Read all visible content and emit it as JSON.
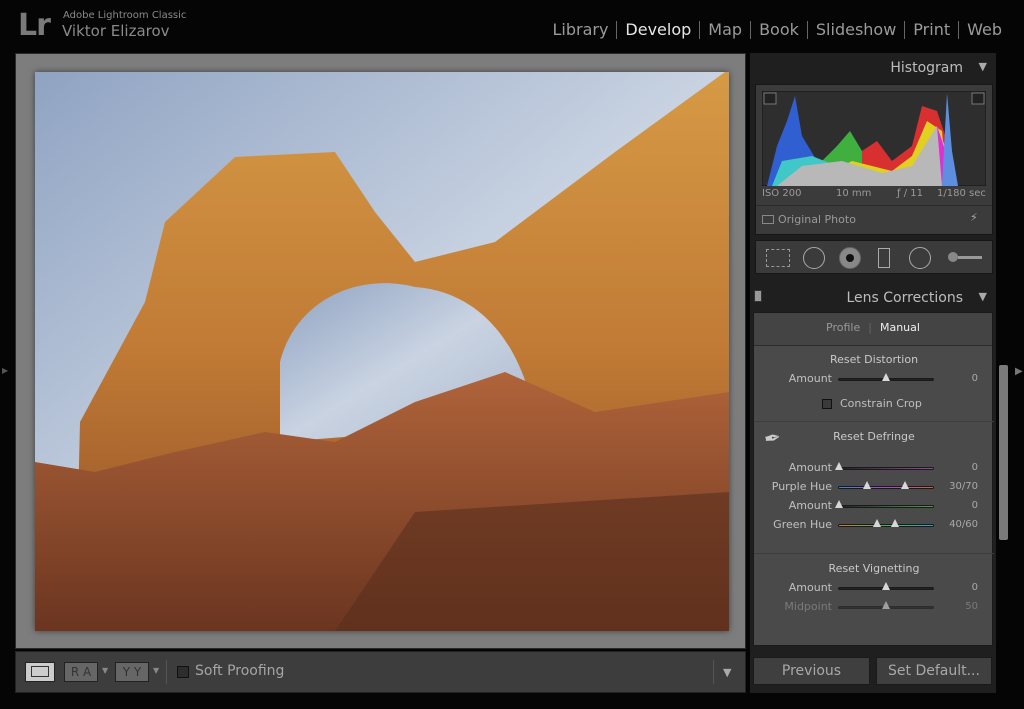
{
  "header": {
    "logo": "Lr",
    "app_name": "Adobe Lightroom Classic",
    "user": "Viktor Elizarov",
    "modules": [
      {
        "label": "Library"
      },
      {
        "label": "Develop",
        "active": true
      },
      {
        "label": "Map"
      },
      {
        "label": "Book"
      },
      {
        "label": "Slideshow"
      },
      {
        "label": "Print"
      },
      {
        "label": "Web"
      }
    ]
  },
  "toolbar": {
    "ra_label": "R A",
    "yy_label": "Y Y",
    "soft_proofing": "Soft Proofing",
    "soft_proofing_checked": false
  },
  "histogram": {
    "title": "Histogram",
    "iso": "ISO 200",
    "focal": "10 mm",
    "aperture": "ƒ / 11",
    "shutter": "1/180 sec",
    "original_photo": "Original Photo"
  },
  "lens": {
    "title": "Lens Corrections",
    "tabs": [
      "Profile",
      "Manual"
    ],
    "active_tab": "Manual",
    "distortion": {
      "title": "Reset Distortion",
      "amount_label": "Amount",
      "amount": "0",
      "amount_fraction": 0.5,
      "constrain_crop": "Constrain Crop",
      "constrain_checked": false
    },
    "defringe": {
      "title": "Reset Defringe",
      "purple_amount_label": "Amount",
      "purple_amount": "0",
      "purple_amount_fraction": 0,
      "purple_hue_label": "Purple Hue",
      "purple_hue": "30/70",
      "purple_hue_fractions": [
        0.3,
        0.7
      ],
      "green_amount_label": "Amount",
      "green_amount": "0",
      "green_amount_fraction": 0,
      "green_hue_label": "Green Hue",
      "green_hue": "40/60",
      "green_hue_fractions": [
        0.4,
        0.6
      ]
    },
    "vignetting": {
      "title": "Reset Vignetting",
      "amount_label": "Amount",
      "amount": "0",
      "amount_fraction": 0.5,
      "midpoint_label": "Midpoint",
      "midpoint": "50",
      "midpoint_fraction": 0.5
    }
  },
  "buttons": {
    "previous": "Previous",
    "set_default": "Set Default..."
  }
}
